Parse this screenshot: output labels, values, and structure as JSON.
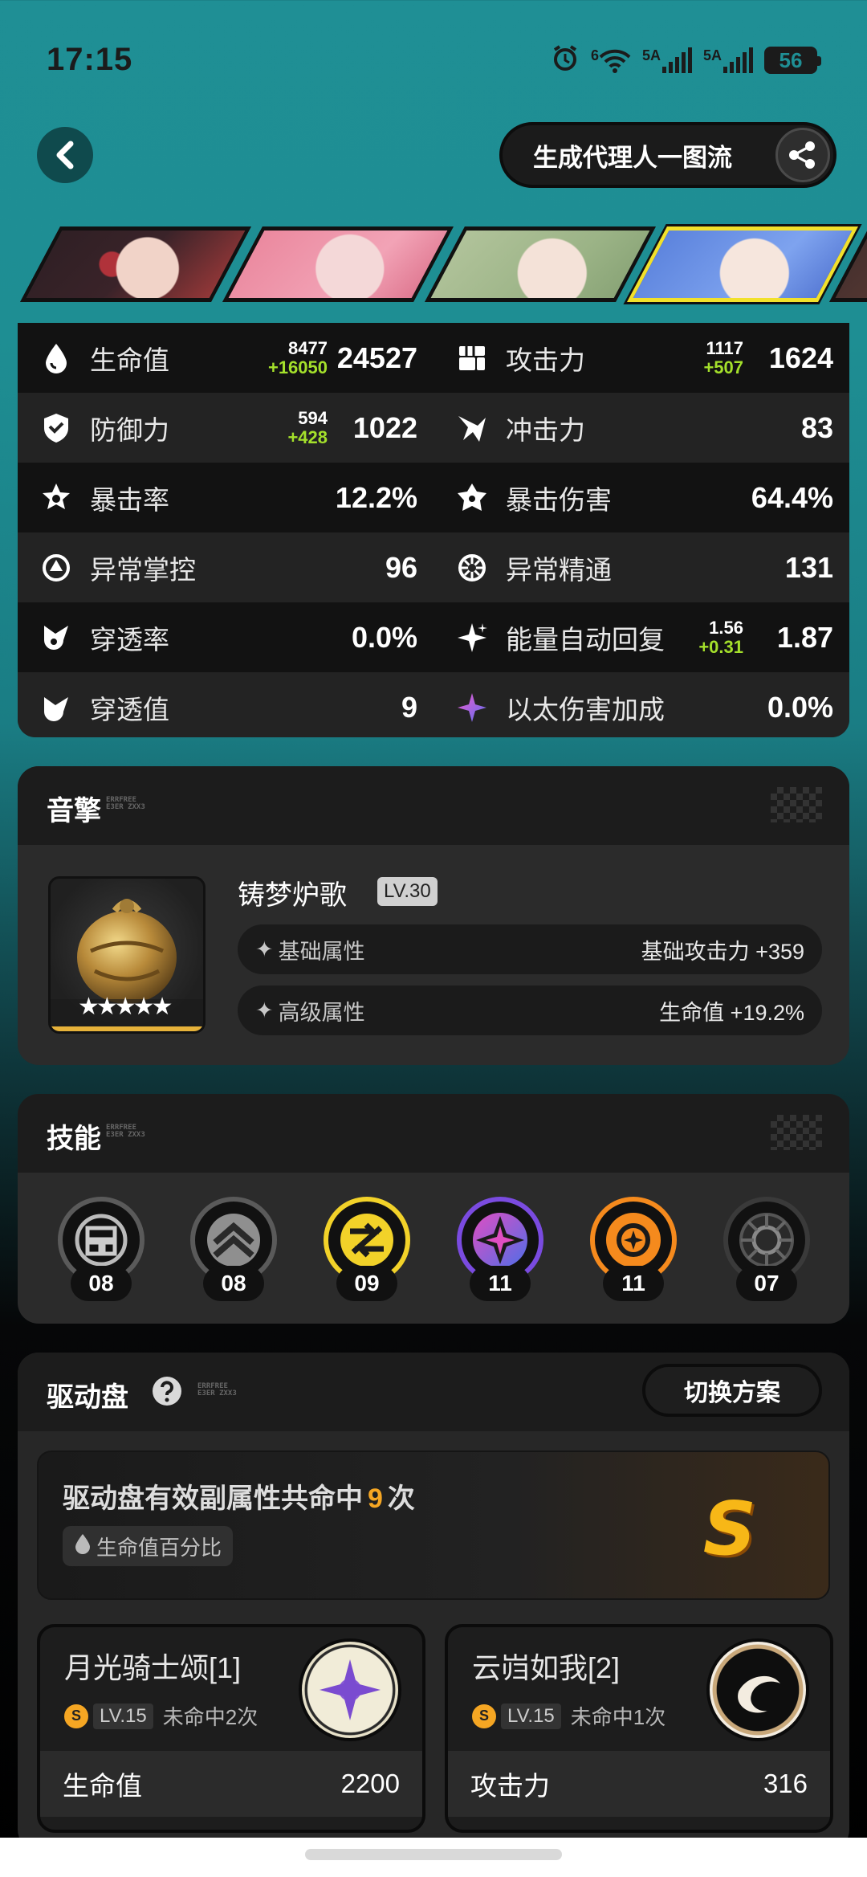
{
  "status_bar": {
    "time": "17:15",
    "wifi_label": "6",
    "signal1_label": "5A",
    "signal2_label": "5A",
    "battery": "56"
  },
  "header": {
    "generate_button": "生成代理人一图流"
  },
  "characters": [
    {
      "name": "agent-1",
      "selected": false
    },
    {
      "name": "agent-2",
      "selected": false
    },
    {
      "name": "agent-3",
      "selected": false
    },
    {
      "name": "agent-4",
      "selected": true
    },
    {
      "name": "agent-5",
      "selected": false
    }
  ],
  "stats": {
    "rows": [
      {
        "left": {
          "label": "生命值",
          "base": "8477",
          "add": "+16050",
          "value": "24527"
        },
        "right": {
          "label": "攻击力",
          "base": "1117",
          "add": "+507",
          "value": "1624"
        }
      },
      {
        "left": {
          "label": "防御力",
          "base": "594",
          "add": "+428",
          "value": "1022"
        },
        "right": {
          "label": "冲击力",
          "value": "83"
        }
      },
      {
        "left": {
          "label": "暴击率",
          "value": "12.2%"
        },
        "right": {
          "label": "暴击伤害",
          "value": "64.4%"
        }
      },
      {
        "left": {
          "label": "异常掌控",
          "value": "96"
        },
        "right": {
          "label": "异常精通",
          "value": "131"
        }
      },
      {
        "left": {
          "label": "穿透率",
          "value": "0.0%"
        },
        "right": {
          "label": "能量自动回复",
          "base": "1.56",
          "add": "+0.31",
          "value": "1.87"
        }
      },
      {
        "left": {
          "label": "穿透值",
          "value": "9"
        },
        "right": {
          "label": "以太伤害加成",
          "value": "0.0%"
        }
      }
    ]
  },
  "engine": {
    "section_title": "音擎",
    "deco_text": "ERRFREE\nE3ER ZXX3",
    "name": "铸梦炉歌",
    "level": "LV.30",
    "stars": "★★★★★",
    "base_label": "基础属性",
    "base_value": "基础攻击力 +359",
    "adv_label": "高级属性",
    "adv_value": "生命值 +19.2%"
  },
  "skills": {
    "section_title": "技能",
    "deco_text": "ERRFREE\nE3ER ZXX3",
    "items": [
      {
        "icon": "basic-attack-icon",
        "level": "08",
        "color": "#9a9a9a"
      },
      {
        "icon": "dodge-icon",
        "level": "08",
        "color": "#9a9a9a"
      },
      {
        "icon": "assist-icon",
        "level": "09",
        "color": "#f2d229"
      },
      {
        "icon": "special-attack-icon",
        "level": "11",
        "color": "#8f4ee8"
      },
      {
        "icon": "chain-attack-icon",
        "level": "11",
        "color": "#f58a1d"
      },
      {
        "icon": "core-skill-icon",
        "level": "07",
        "color": "#9a9a9a"
      }
    ]
  },
  "drive_disc": {
    "section_title": "驱动盘",
    "deco_text": "ERRFREE\nE3ER ZXX3",
    "switch_button": "切换方案",
    "summary_prefix": "驱动盘有效副属性共命中",
    "summary_count": "9",
    "summary_suffix": "次",
    "summary_tag": "生命值百分比",
    "rank": "S",
    "discs": [
      {
        "name": "月光骑士颂[1]",
        "coin": "S",
        "level": "LV.15",
        "miss": "未命中2次",
        "main_label": "生命值",
        "main_value": "2200"
      },
      {
        "name": "云岿如我[2]",
        "coin": "S",
        "level": "LV.15",
        "miss": "未命中1次",
        "main_label": "攻击力",
        "main_value": "316"
      }
    ]
  }
}
